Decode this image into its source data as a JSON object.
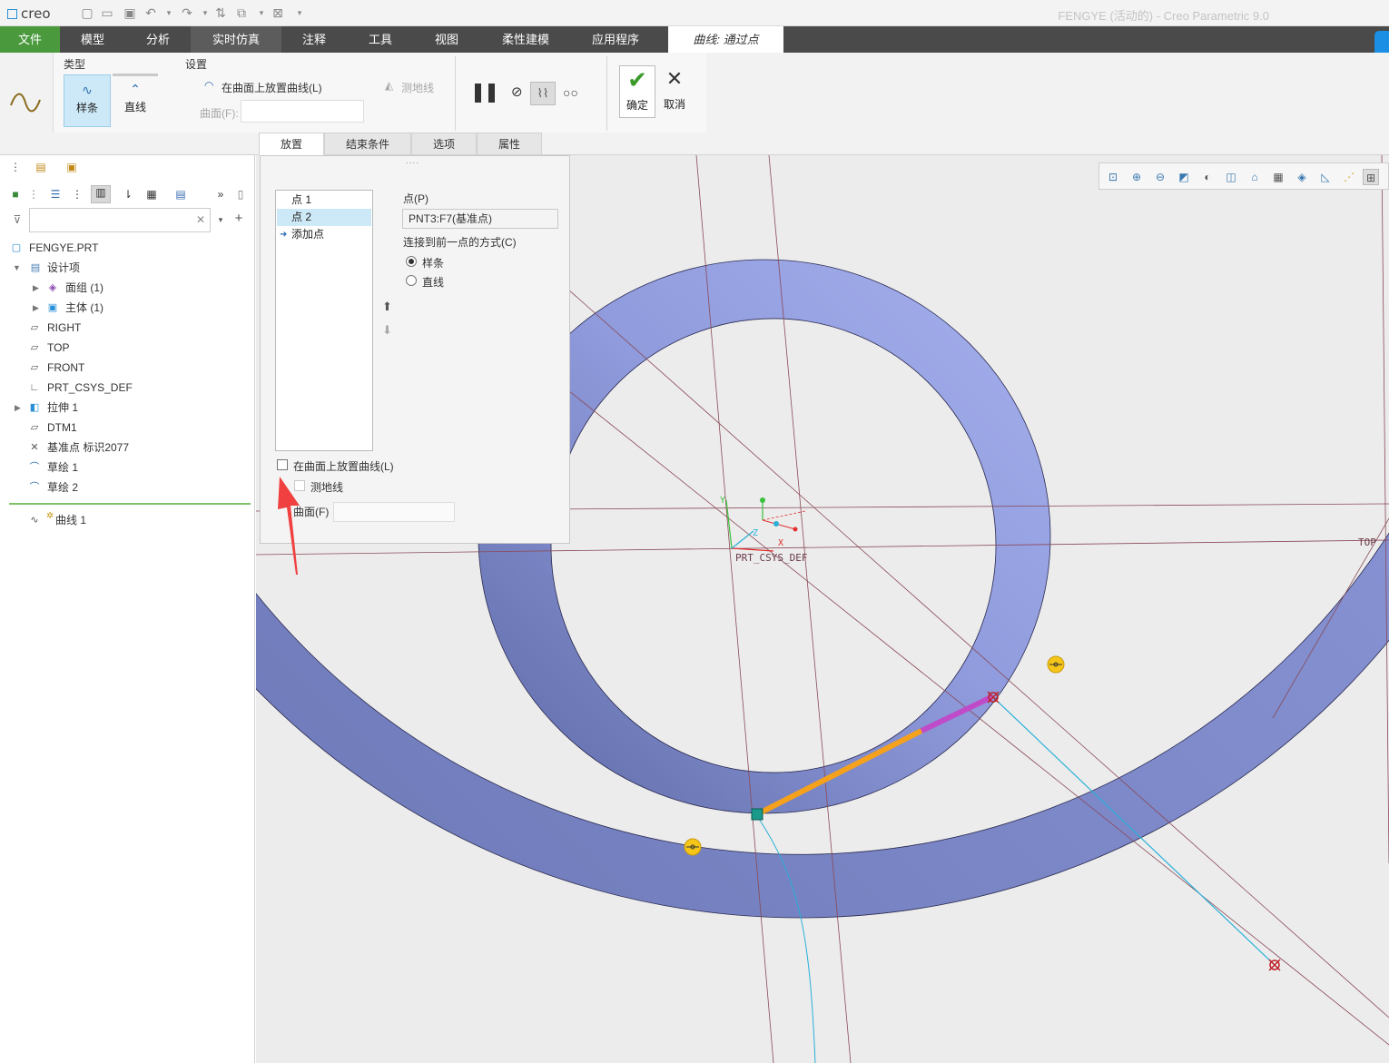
{
  "app": {
    "logo": "creo",
    "title": "FENGYE (活动的) - Creo Parametric 9.0"
  },
  "tabs": [
    {
      "label": "文件"
    },
    {
      "label": "模型"
    },
    {
      "label": "分析"
    },
    {
      "label": "实时仿真"
    },
    {
      "label": "注释"
    },
    {
      "label": "工具"
    },
    {
      "label": "视图"
    },
    {
      "label": "柔性建模"
    },
    {
      "label": "应用程序"
    },
    {
      "label": "曲线: 通过点"
    }
  ],
  "ribbon": {
    "type_group": "类型",
    "spline": "样条",
    "line": "直线",
    "settings_group": "设置",
    "place_on_surface": "在曲面上放置曲线(L)",
    "geodesic": "测地线",
    "surface_label": "曲面(F):",
    "ok": "确定",
    "cancel": "取消",
    "subtabs": [
      "放置",
      "结束条件",
      "选项",
      "属性"
    ]
  },
  "left_panel": {
    "search_placeholder": "",
    "tree": [
      {
        "label": "FENGYE.PRT",
        "icon": "part-icon"
      },
      {
        "label": "设计项",
        "icon": "design-items-icon"
      },
      {
        "label": "面组 (1)",
        "icon": "quilt-icon"
      },
      {
        "label": "主体 (1)",
        "icon": "body-icon"
      },
      {
        "label": "RIGHT",
        "icon": "datum-plane-icon"
      },
      {
        "label": "TOP",
        "icon": "datum-plane-icon"
      },
      {
        "label": "FRONT",
        "icon": "datum-plane-icon"
      },
      {
        "label": "PRT_CSYS_DEF",
        "icon": "csys-icon"
      },
      {
        "label": "拉伸 1",
        "icon": "extrude-icon"
      },
      {
        "label": "DTM1",
        "icon": "datum-plane-icon"
      },
      {
        "label": "基准点 标识2077",
        "icon": "datum-point-icon"
      },
      {
        "label": "草绘 1",
        "icon": "sketch-icon"
      },
      {
        "label": "草绘 2",
        "icon": "sketch-icon"
      },
      {
        "label": "曲线 1",
        "icon": "curve-icon"
      }
    ]
  },
  "dialog": {
    "points": [
      "点 1",
      "点 2"
    ],
    "add_point": "添加点",
    "point_label": "点(P)",
    "point_value": "PNT3:F7(基准点)",
    "connect_label": "连接到前一点的方式(C)",
    "opt_spline": "样条",
    "opt_line": "直线",
    "place_on_surface": "在曲面上放置曲线(L)",
    "geodesic": "测地线",
    "surface_label": "曲面(F)",
    "drag_handle": "....",
    "selected_connect": "样条"
  },
  "graphics": {
    "csys_label": "PRT_CSYS_DEF",
    "axis_x": "X",
    "axis_y": "Y",
    "axis_z": "Z",
    "plane_label": "TOP",
    "colors": {
      "ring": "#8a96d8",
      "ring_dark": "#5e6aa6",
      "background": "#ececec",
      "highlight_orange": "#f5a11c",
      "highlight_magenta": "#c04bc8",
      "curve_cyan": "#2ab0d8",
      "datum_line": "#8a4a58"
    }
  }
}
